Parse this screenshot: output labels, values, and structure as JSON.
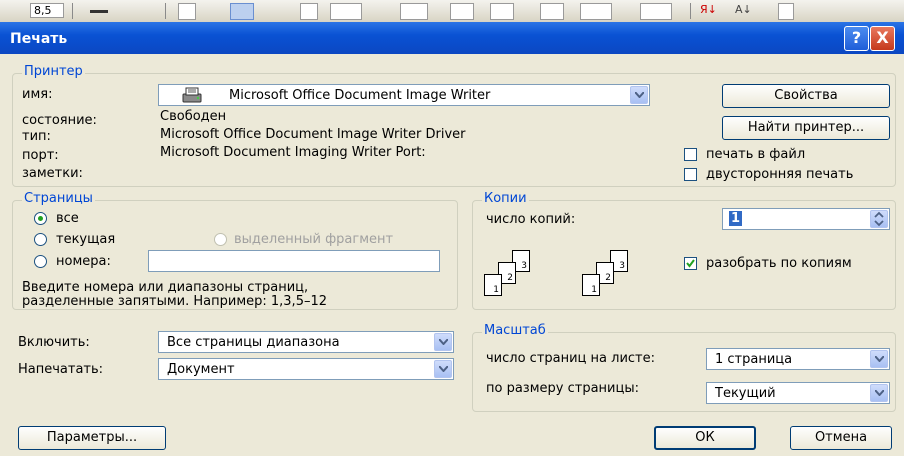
{
  "toolbar": {
    "font_size_partial": "8,5"
  },
  "window": {
    "title": "Печать",
    "help_label": "?",
    "close_label": "X"
  },
  "printer": {
    "legend": "Принтер",
    "name_label": "имя:",
    "name_value": "Microsoft Office Document Image Writer",
    "status_label": "состояние:",
    "status_value": "Свободен",
    "type_label": "тип:",
    "type_value": "Microsoft Office Document Image Writer Driver",
    "port_label": "порт:",
    "port_value": "Microsoft Document Imaging Writer Port:",
    "notes_label": "заметки:",
    "properties_button": "Свойства",
    "find_printer_button": "Найти принтер...",
    "print_to_file_label": "печать в файл",
    "print_to_file_checked": false,
    "duplex_label": "двусторонняя печать",
    "duplex_checked": false
  },
  "pages": {
    "legend": "Страницы",
    "all_label": "все",
    "current_label": "текущая",
    "selection_label": "выделенный фрагмент",
    "numbers_label": "номера:",
    "numbers_value": "",
    "hint_line1": "Введите номера или диапазоны страниц,",
    "hint_line2": "разделенные запятыми. Например: 1,3,5–12",
    "selected": "all"
  },
  "copies": {
    "legend": "Копии",
    "count_label": "число копий:",
    "count_value": "1",
    "collate_label": "разобрать по копиям",
    "collate_checked": true,
    "page_labels": [
      "1",
      "2",
      "3"
    ]
  },
  "include": {
    "label": "Включить:",
    "value": "Все страницы диапазона"
  },
  "print_what": {
    "label": "Напечатать:",
    "value": "Документ"
  },
  "scale": {
    "legend": "Масштаб",
    "pages_per_sheet_label": "число страниц на листе:",
    "pages_per_sheet_value": "1 страница",
    "fit_to_label": "по размеру страницы:",
    "fit_to_value": "Текущий"
  },
  "footer": {
    "options_button": "Параметры...",
    "ok_button": "ОК",
    "cancel_button": "Отмена"
  },
  "colors": {
    "title_bar": "#0A52D4",
    "dialog_bg": "#ECE9D8",
    "legend_text": "#0046D5",
    "check_mark": "#21A121"
  }
}
